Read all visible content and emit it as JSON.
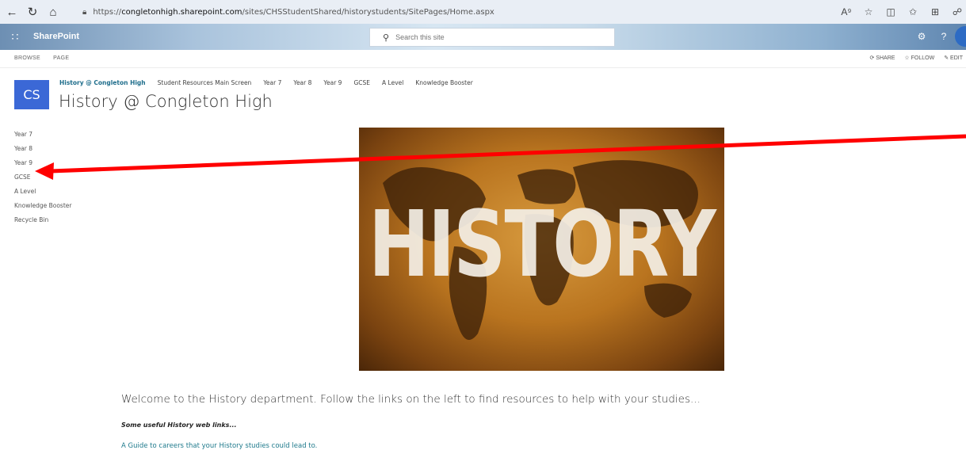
{
  "browser": {
    "url_prefix": "https://",
    "url_host": "congletonhigh.sharepoint.com",
    "url_path": "/sites/CHSStudentShared/historystudents/SitePages/Home.aspx",
    "icons": [
      "read-aloud-icon",
      "favorite-icon",
      "split-screen-icon",
      "favorites-bar-icon",
      "collections-icon",
      "extensions-icon"
    ]
  },
  "suite": {
    "app_name": "SharePoint",
    "search_placeholder": "Search this site"
  },
  "ribbon": {
    "tabs": [
      "BROWSE",
      "PAGE"
    ],
    "share": "SHARE",
    "follow": "FOLLOW",
    "edit": "EDIT"
  },
  "site": {
    "logo_text": "CS",
    "title": "History @ Congleton High",
    "top_nav": [
      "History @ Congleton High",
      "Student Resources Main Screen",
      "Year 7",
      "Year 8",
      "Year 9",
      "GCSE",
      "A Level",
      "Knowledge Booster"
    ],
    "left_nav": [
      "Year 7",
      "Year 8",
      "Year 9",
      "GCSE",
      "A Level",
      "Knowledge Booster",
      "Recycle Bin"
    ]
  },
  "content": {
    "hero_word": "HISTORY",
    "welcome": "Welcome to the History department. Follow the links on the left to find resources to help with your studies...",
    "links_heading": "Some useful History web links...",
    "career_link": "A Guide to careers that your History studies could lead to."
  },
  "colors": {
    "accent": "#3b68d6",
    "link": "#1f7a8c",
    "annotation": "#ff0000"
  }
}
